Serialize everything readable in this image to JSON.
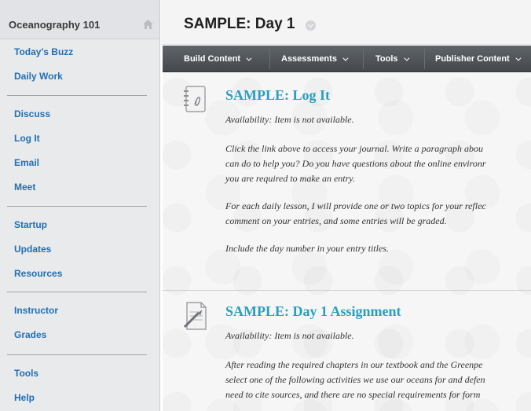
{
  "sidebar": {
    "course_title": "Oceanography 101",
    "groups": [
      [
        "Today's Buzz",
        "Daily Work"
      ],
      [
        "Discuss",
        "Log It",
        "Email",
        "Meet"
      ],
      [
        "Startup",
        "Updates",
        "Resources"
      ],
      [
        "Instructor",
        "Grades"
      ],
      [
        "Tools",
        "Help"
      ]
    ]
  },
  "header": {
    "title": "SAMPLE: Day 1"
  },
  "menubar": {
    "items": [
      "Build Content",
      "Assessments",
      "Tools",
      "Publisher Content"
    ]
  },
  "content": {
    "items": [
      {
        "title": "SAMPLE: Log It",
        "availability": "Availability:  Item is not available.",
        "paragraphs": [
          "Click the link above to access your journal. Write a paragraph abou",
          "can do to help you? Do you have questions about the online environr",
          "you are required to make an entry.",
          "For each daily lesson, I will provide one or two topics for your reflec",
          "comment on your entries, and some entries will be graded.",
          "Include the day number in your entry titles."
        ]
      },
      {
        "title": "SAMPLE: Day 1 Assignment",
        "availability": "Availability:  Item is not available.",
        "paragraphs": [
          "After reading the required chapters in our textbook and the Greenpe",
          "select one of the following activities we use our oceans for and defen",
          "need to cite sources, and there are no special requirements for form"
        ]
      }
    ]
  },
  "colors": {
    "link": "#1f6fb4",
    "item_title": "#2a9ec0",
    "menubar": "#4c5054"
  },
  "icons": {
    "home": "home-icon",
    "title_menu": "chevron-down-icon",
    "journal": "journal-icon",
    "assignment": "assignment-icon"
  }
}
